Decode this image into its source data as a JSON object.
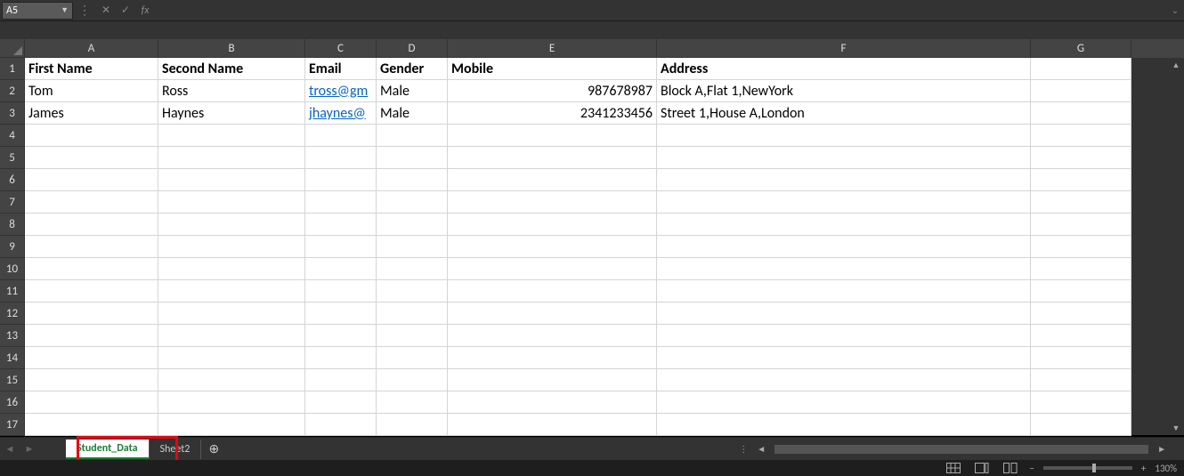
{
  "formula_bar": {
    "name_box": "A5",
    "cancel_icon": "✕",
    "confirm_icon": "✓",
    "fx_label": "fx",
    "formula_value": "",
    "expand_icon": "⌄"
  },
  "columns": [
    "A",
    "B",
    "C",
    "D",
    "E",
    "F",
    "G"
  ],
  "row_numbers": [
    1,
    2,
    3,
    4,
    5,
    6,
    7,
    8,
    9,
    10,
    11,
    12,
    13,
    14,
    15,
    16,
    17
  ],
  "header_row": {
    "A": "First Name",
    "B": "Second Name",
    "C": "Email",
    "D": "Gender",
    "E": "Mobile",
    "F": "Address"
  },
  "data_rows": [
    {
      "A": "Tom",
      "B": "Ross",
      "C": "tross@gm",
      "D": "Male",
      "E": "987678987",
      "F": "Block A,Flat 1,NewYork"
    },
    {
      "A": "James",
      "B": "Haynes",
      "C": "jhaynes@",
      "D": "Male",
      "E": "2341233456",
      "F": "Street 1,House A,London"
    }
  ],
  "sheet_tabs": {
    "active": "Student_Data",
    "tab2": "Sheet2",
    "new": "⊕"
  },
  "status": {
    "zoom_percent": "130%",
    "zoom_minus": "−",
    "zoom_plus": "+"
  }
}
